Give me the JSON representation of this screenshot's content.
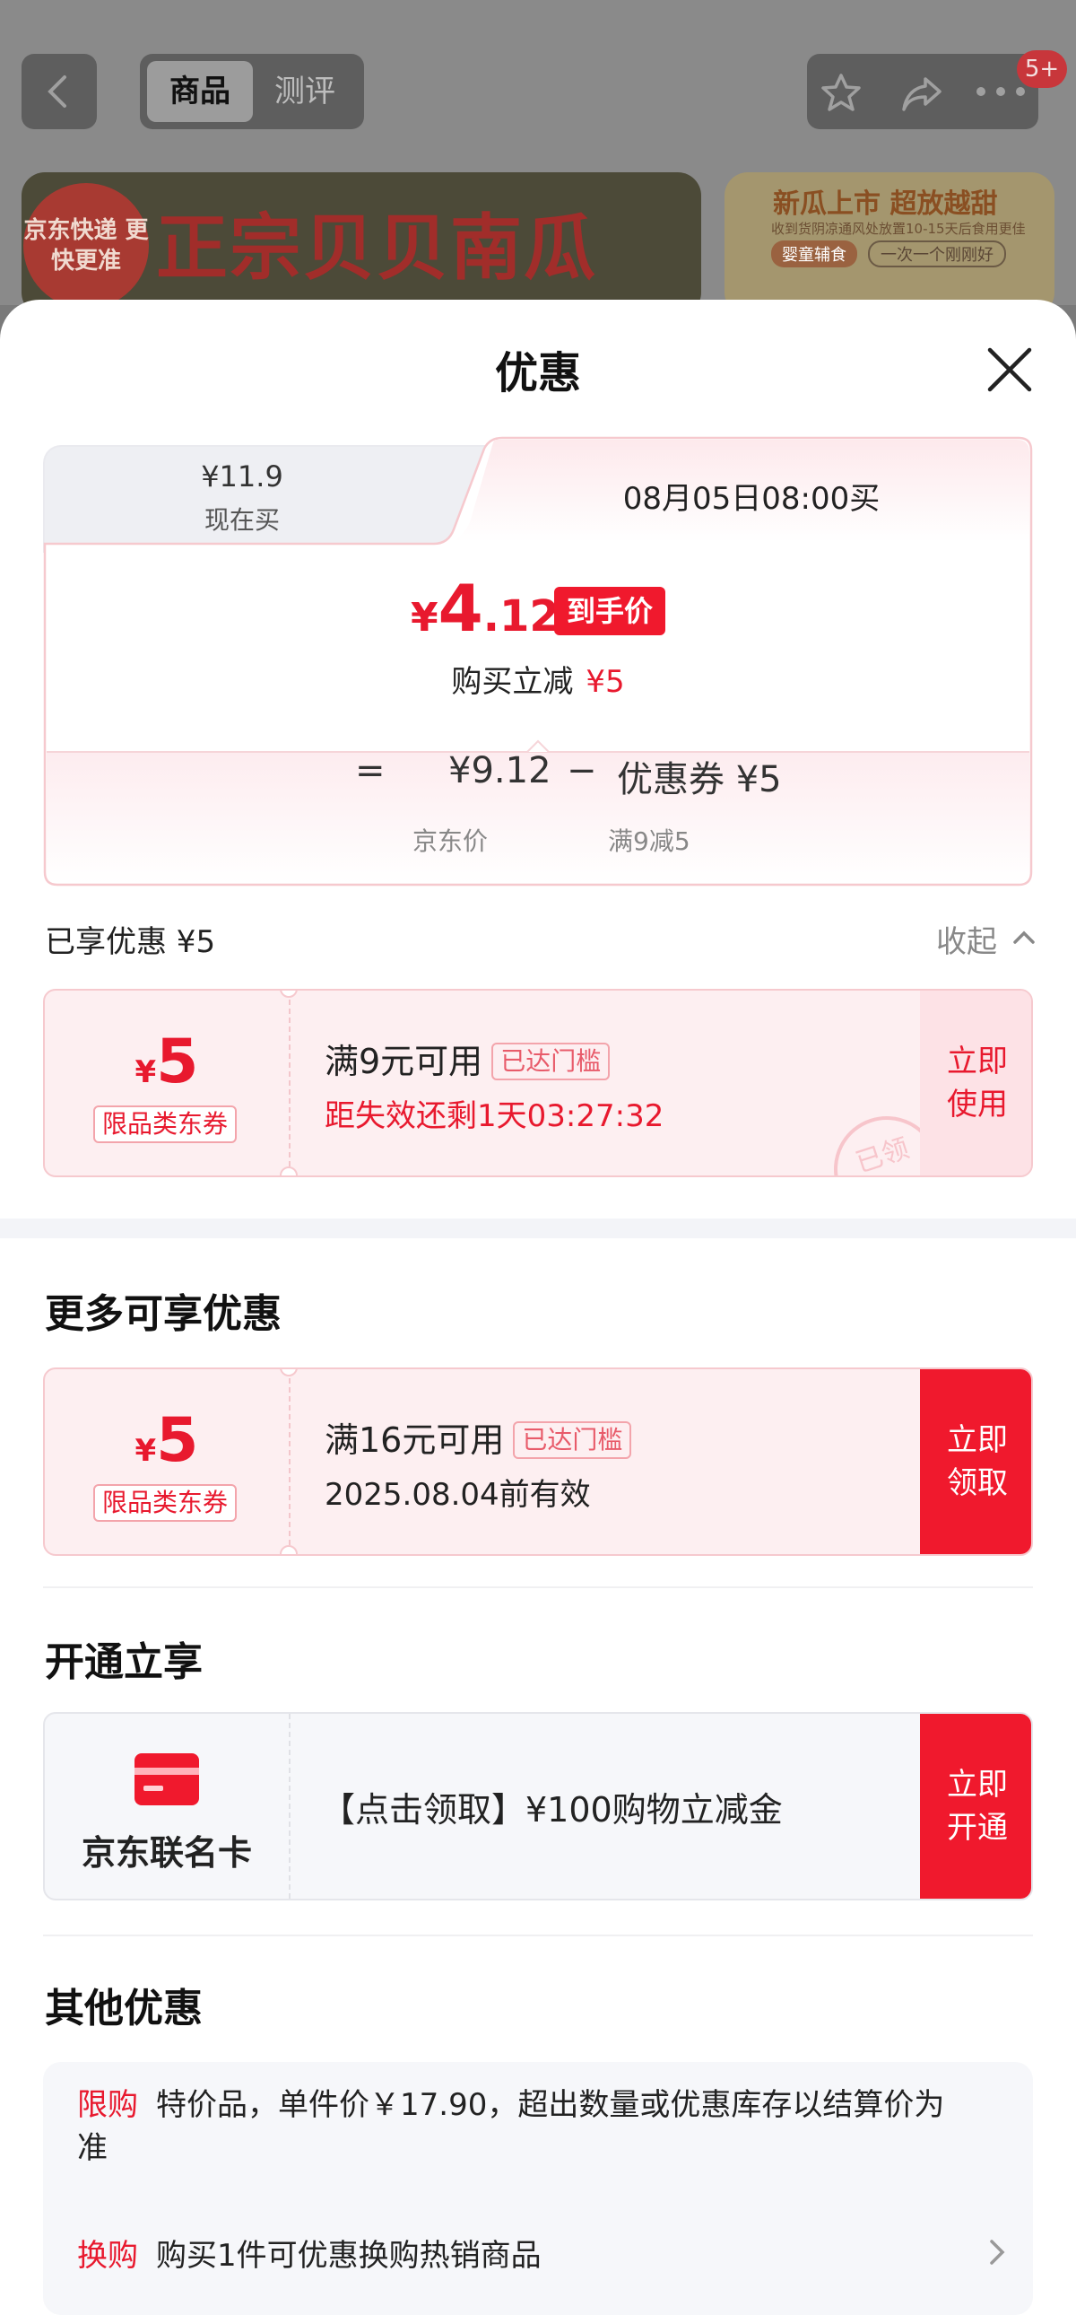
{
  "background": {
    "segment_tabs": [
      "商品",
      "测评"
    ],
    "badge_count": "5+",
    "banner_left": {
      "logo_text": "京东快递 更快更准",
      "title": "正宗贝贝南瓜"
    },
    "banner_right": {
      "line1": "新瓜上市 超放越甜",
      "line2": "收到货阴凉通风处放置10-15天后食用更佳",
      "pill1": "婴童辅食",
      "pill2": "一次一个刚刚好"
    }
  },
  "sheet": {
    "title": "优惠",
    "price_tabs": {
      "now_price": "¥11.9",
      "now_label": "现在买",
      "future_label": "08月05日08:00买"
    },
    "final_price": {
      "currency": "¥",
      "integer": "4",
      "decimal": ".12",
      "tag": "到手价"
    },
    "instant_reduce": {
      "label": "购买立减",
      "amount": "¥5"
    },
    "equation": {
      "equals": "=",
      "base_price": "¥9.12",
      "minus": "−",
      "coupon": "优惠券 ¥5",
      "base_label": "京东价",
      "coupon_label": "满9减5"
    },
    "enjoyed": {
      "label": "已享优惠 ¥5",
      "collapse": "收起"
    },
    "coupon_enjoyed": {
      "currency": "¥",
      "amount": "5",
      "type": "限品类东券",
      "condition": "满9元可用",
      "reached": "已达门槛",
      "countdown": "距失效还剩1天03:27:32",
      "action": [
        "立即",
        "使用"
      ],
      "stamp": "已领"
    },
    "more": {
      "heading": "更多可享优惠",
      "coupon": {
        "currency": "¥",
        "amount": "5",
        "type": "限品类东券",
        "condition": "满16元可用",
        "reached": "已达门槛",
        "validity": "2025.08.04前有效",
        "action": [
          "立即",
          "领取"
        ]
      }
    },
    "activate": {
      "heading": "开通立享",
      "card_name": "京东联名卡",
      "desc": "【点击领取】¥100购物立减金",
      "action": [
        "立即",
        "开通"
      ]
    },
    "other": {
      "heading": "其他优惠",
      "items": [
        {
          "tag": "限购",
          "text": "特价品，单件价￥17.90，超出数量或优惠库存以结算价为准"
        },
        {
          "tag": "换购",
          "text": "购买1件可优惠换购热销商品"
        }
      ]
    }
  },
  "colors": {
    "accent": "#e8192e",
    "accent_bg": "#fdeff1",
    "panel": "#f6f7fa"
  }
}
